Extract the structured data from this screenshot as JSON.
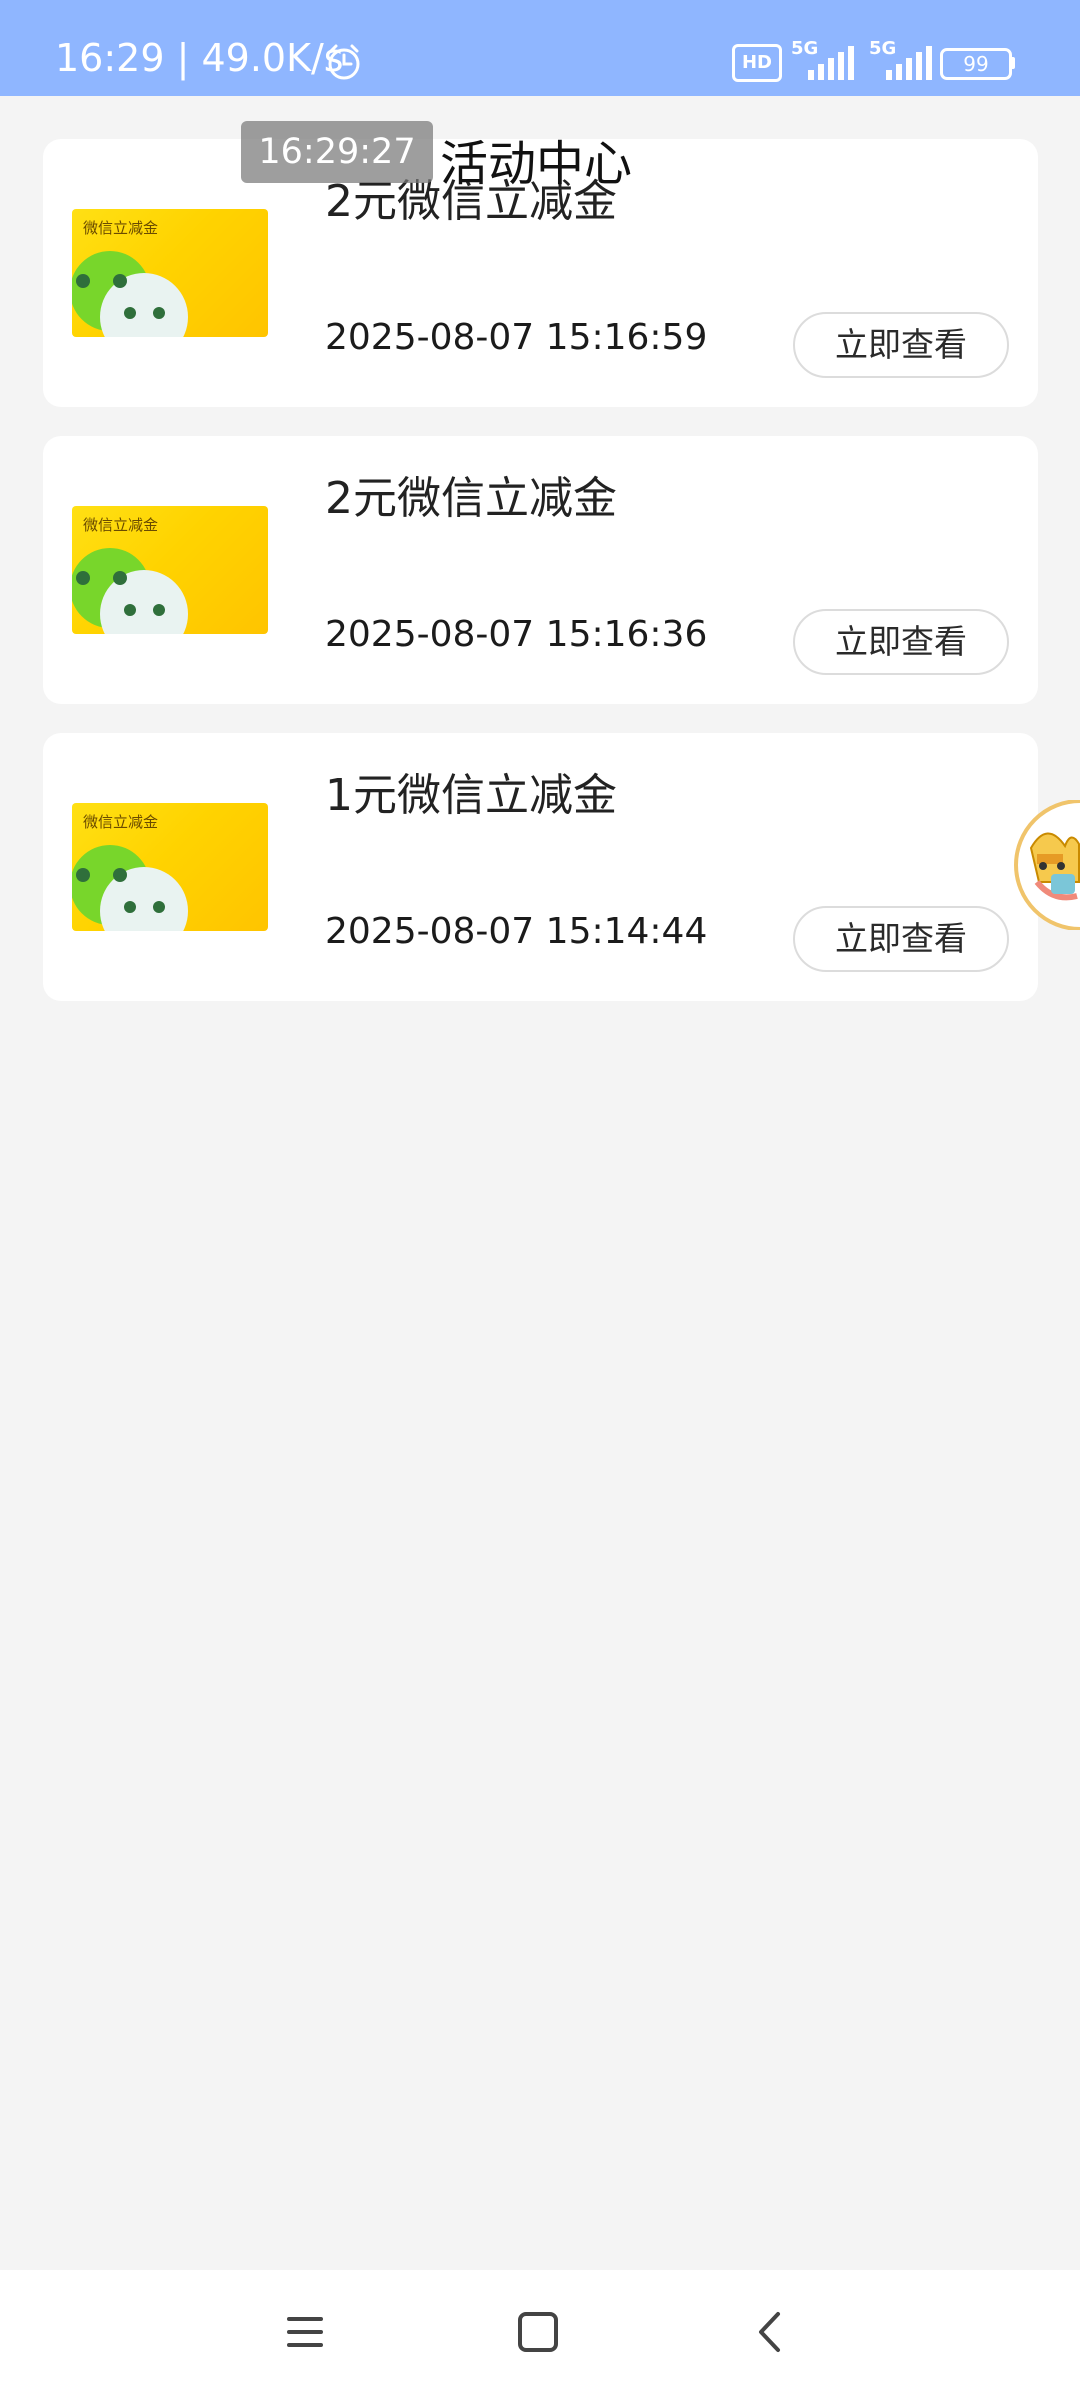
{
  "status_bar": {
    "time_speed": "16:29 | 49.0K/s",
    "hd_label": "HD",
    "network_1": "5G",
    "network_2": "5G",
    "battery": "99",
    "icons": [
      "alarm-icon",
      "signal-icon",
      "battery-icon"
    ]
  },
  "header": {
    "time_overlay": "16:29:27",
    "title": "活动中心"
  },
  "thumbnail_label": "微信立减金",
  "items": [
    {
      "title": "2元微信立减金",
      "time": "2025-08-07 15:16:59",
      "button": "立即查看"
    },
    {
      "title": "2元微信立减金",
      "time": "2025-08-07 15:16:36",
      "button": "立即查看"
    },
    {
      "title": "1元微信立减金",
      "time": "2025-08-07 15:14:44",
      "button": "立即查看"
    }
  ],
  "colors": {
    "status_bar": "#8fb6ff",
    "background": "#f4f4f4",
    "card": "#ffffff",
    "thumbnail_yellow": "#ffd300",
    "thumbnail_green": "#78d62b"
  },
  "nav": {
    "icons": [
      "menu-icon",
      "home-icon",
      "back-icon"
    ]
  }
}
